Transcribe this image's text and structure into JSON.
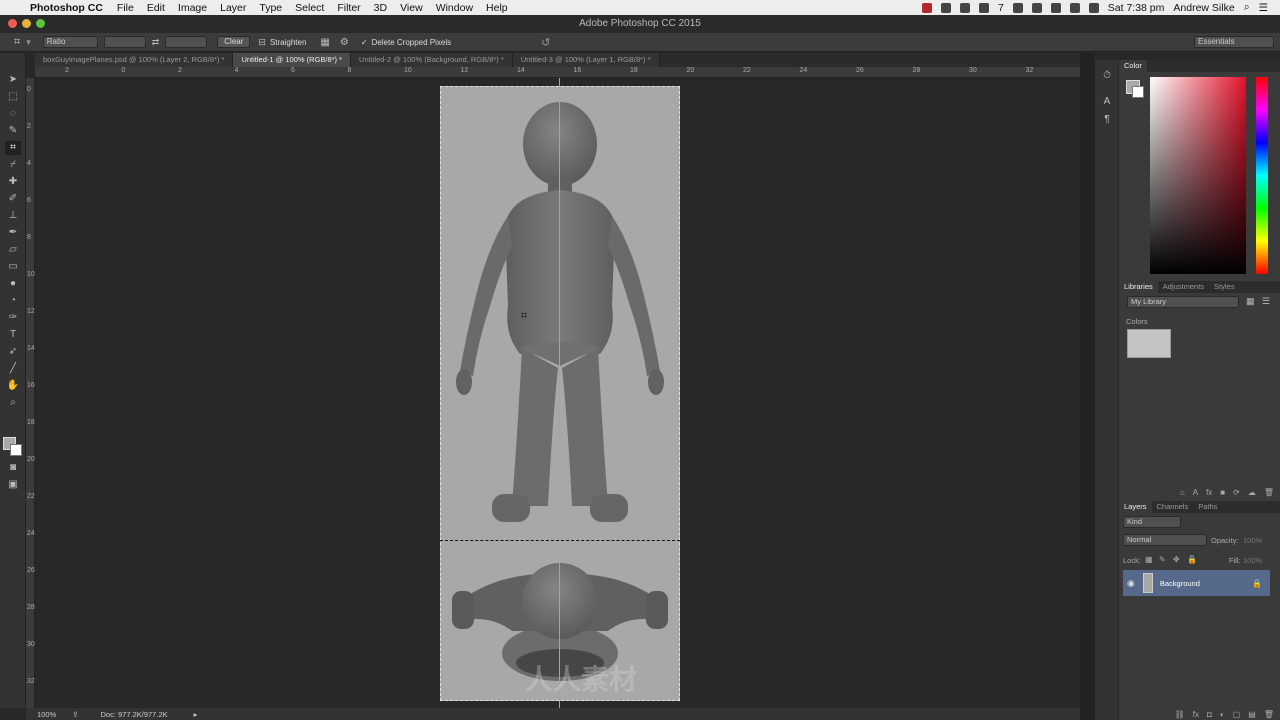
{
  "menubar": {
    "app_name": "Photoshop CC",
    "items": [
      "File",
      "Edit",
      "Image",
      "Layer",
      "Type",
      "Select",
      "Filter",
      "3D",
      "View",
      "Window",
      "Help"
    ],
    "clock": "Sat 7:38 pm",
    "user": "Andrew Silke",
    "battery_label": "7"
  },
  "window": {
    "title": "Adobe Photoshop CC 2015"
  },
  "options": {
    "ratio_label": "Ratio",
    "clear_label": "Clear",
    "straighten_label": "Straighten",
    "delete_cropped_label": "Delete Cropped Pixels",
    "delete_cropped_checked": true,
    "workspace_label": "Essentials"
  },
  "tabs": [
    {
      "label": "boxGuyImagePlanes.psd @ 100% (Layer 2, RGB/8*) *",
      "active": false
    },
    {
      "label": "Untitled-1 @ 100% (RGB/8*) *",
      "active": true
    },
    {
      "label": "Untitled-2 @ 100% (Background, RGB/8*) *",
      "active": false
    },
    {
      "label": "Untitled-3 @ 100% (Layer 1, RGB/8*) *",
      "active": false
    }
  ],
  "ruler": {
    "h_labels": [
      "2",
      "0",
      "2",
      "4",
      "6",
      "8",
      "10",
      "12",
      "14",
      "16",
      "18",
      "20",
      "22",
      "24",
      "26",
      "28",
      "30",
      "32"
    ],
    "v_labels": [
      "0",
      "2",
      "4",
      "6",
      "8",
      "10",
      "12",
      "14",
      "16",
      "18",
      "20",
      "22",
      "24",
      "26",
      "28",
      "30",
      "32"
    ]
  },
  "status": {
    "zoom": "100%",
    "doc_info": "Doc: 977.2K/977.2K"
  },
  "panels": {
    "color_title": "Color",
    "libraries_tabs": [
      "Libraries",
      "Adjustments",
      "Styles"
    ],
    "library_name": "My Library",
    "colors_section": "Colors",
    "layers_tabs": [
      "Layers",
      "Channels",
      "Paths"
    ],
    "kind_label": "Kind",
    "blend_mode": "Normal",
    "opacity_label": "Opacity:",
    "opacity_value": "100%",
    "lock_label": "Lock:",
    "fill_label": "Fill:",
    "fill_value": "100%",
    "layer_name": "Background"
  },
  "colors": {
    "accent_layer": "#56698a",
    "guide": "#33d6d6",
    "canvas": "#a8a8a8",
    "foreground_swatch": "#a8a8a8"
  },
  "watermark": "人人素材"
}
